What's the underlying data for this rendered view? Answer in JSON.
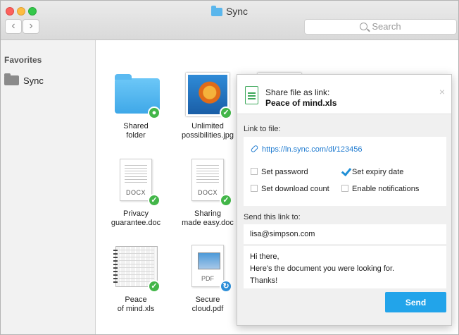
{
  "window": {
    "title": "Sync",
    "search_placeholder": "Search",
    "nav_back": "‹",
    "nav_forward": "›"
  },
  "sidebar": {
    "heading": "Favorites",
    "items": [
      {
        "label": "Sync",
        "icon": "folder-icon"
      }
    ]
  },
  "files": [
    {
      "name_line1": "Shared",
      "name_line2": "folder",
      "kind": "folder",
      "badge": "user-icon"
    },
    {
      "name_line1": "Unlimited",
      "name_line2": "possibilities.jpg",
      "kind": "photo",
      "badge": "check-icon"
    },
    {
      "name_line1": "Privacy",
      "name_line2": "guarantee.doc",
      "kind": "docx",
      "type_label": "DOCX",
      "badge": "check-icon"
    },
    {
      "name_line1": "Sharing",
      "name_line2": "made easy.doc",
      "kind": "docx",
      "type_label": "DOCX",
      "badge": "check-icon"
    },
    {
      "name_line1": "Peace",
      "name_line2": "of mind.xls",
      "kind": "spreadsheet",
      "badge": "check-icon"
    },
    {
      "name_line1": "Secure",
      "name_line2": "cloud.pdf",
      "kind": "pdf",
      "type_label": "PDF",
      "badge": "sync-icon"
    }
  ],
  "share_panel": {
    "heading": "Share file as link:",
    "file_name": "Peace of mind.xls",
    "close": "×",
    "link_label": "Link to file:",
    "link_url": "https://ln.sync.com/dl/123456",
    "options": [
      {
        "label": "Set password",
        "checked": false
      },
      {
        "label": "Set expiry date",
        "checked": true
      },
      {
        "label": "Set download count",
        "checked": false
      },
      {
        "label": "Enable notifications",
        "checked": false
      }
    ],
    "send_label": "Send this link to:",
    "recipient": "lisa@simpson.com",
    "message_lines": [
      "Hi there,",
      "Here's the document you were looking for.",
      "Thanks!"
    ],
    "send_button": "Send"
  },
  "colors": {
    "accent": "#22a4ea",
    "check": "#43b649",
    "link": "#1f7bd0"
  }
}
